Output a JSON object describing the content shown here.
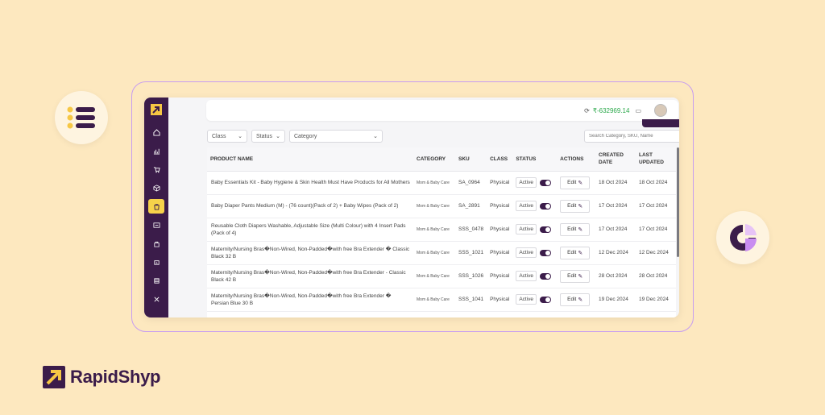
{
  "brand": {
    "name": "RapidShyp"
  },
  "colors": {
    "accent": "#3b1c4a",
    "highlight": "#f6d24a",
    "wallet": "#2aa84a",
    "background": "#fde8bf"
  },
  "topbar": {
    "wallet_amount": "₹-63296​9.14",
    "refresh_icon": "refresh-icon",
    "folder_icon": "folder-icon"
  },
  "filters": {
    "class_label": "Class",
    "status_label": "Status",
    "category_label": "Category"
  },
  "search": {
    "placeholder": "Search Category, SKU, Name"
  },
  "table": {
    "headers": {
      "product_name": "PRODUCT NAME",
      "category": "CATEGORY",
      "sku": "SKU",
      "class": "CLASS",
      "status": "STATUS",
      "actions": "ACTIONS",
      "created": "CREATED DATE",
      "updated": "LAST UPDATED"
    },
    "rows": [
      {
        "name": "Baby Essentials Kit - Baby Hygiene & Skin Health Must Have Products for All Mothers",
        "category": "Mom & Baby Care",
        "sku": "SA_0964",
        "cls": "Physical",
        "status": "Active",
        "action": "Edit",
        "created": "18 Oct 2024",
        "updated": "18 Oct 2024"
      },
      {
        "name": "Baby Diaper Pants Medium (M) - (76 count)(Pack of 2) + Baby Wipes (Pack of 2)",
        "category": "Mom & Baby Care",
        "sku": "SA_2891",
        "cls": "Physical",
        "status": "Active",
        "action": "Edit",
        "created": "17 Oct 2024",
        "updated": "17 Oct 2024"
      },
      {
        "name": "Reusable Cloth Diapers Washable, Adjustable Size (Multi Colour) with 4 Insert Pads (Pack of 4)",
        "category": "Mom & Baby Care",
        "sku": "SSS_0478",
        "cls": "Physical",
        "status": "Active",
        "action": "Edit",
        "created": "17 Oct 2024",
        "updated": "17 Oct 2024"
      },
      {
        "name": "Maternity/Nursing Bras�Non-Wired, Non-Padded�with free Bra Extender � Classic Black 32 B",
        "category": "Mom & Baby Care",
        "sku": "SSS_1021",
        "cls": "Physical",
        "status": "Active",
        "action": "Edit",
        "created": "12 Dec 2024",
        "updated": "12 Dec 2024"
      },
      {
        "name": "Maternity/Nursing Bras�Non-Wired, Non-Padded�with free Bra Extender - Classic Black 42 B",
        "category": "Mom & Baby Care",
        "sku": "SSS_1026",
        "cls": "Physical",
        "status": "Active",
        "action": "Edit",
        "created": "28 Oct 2024",
        "updated": "28 Oct 2024"
      },
      {
        "name": "Maternity/Nursing Bras�Non-Wired, Non-Padded�with free Bra Extender � Persian Blue 30 B",
        "category": "Mom & Baby Care",
        "sku": "SSS_1041",
        "cls": "Physical",
        "status": "Active",
        "action": "Edit",
        "created": "19 Dec 2024",
        "updated": "19 Dec 2024"
      }
    ]
  },
  "sidebar": {
    "items": [
      "home-icon",
      "analytics-icon",
      "cart-icon",
      "package-icon",
      "products-icon",
      "shipping-icon",
      "bag-icon",
      "returns-icon",
      "reports-icon",
      "tools-icon"
    ]
  }
}
